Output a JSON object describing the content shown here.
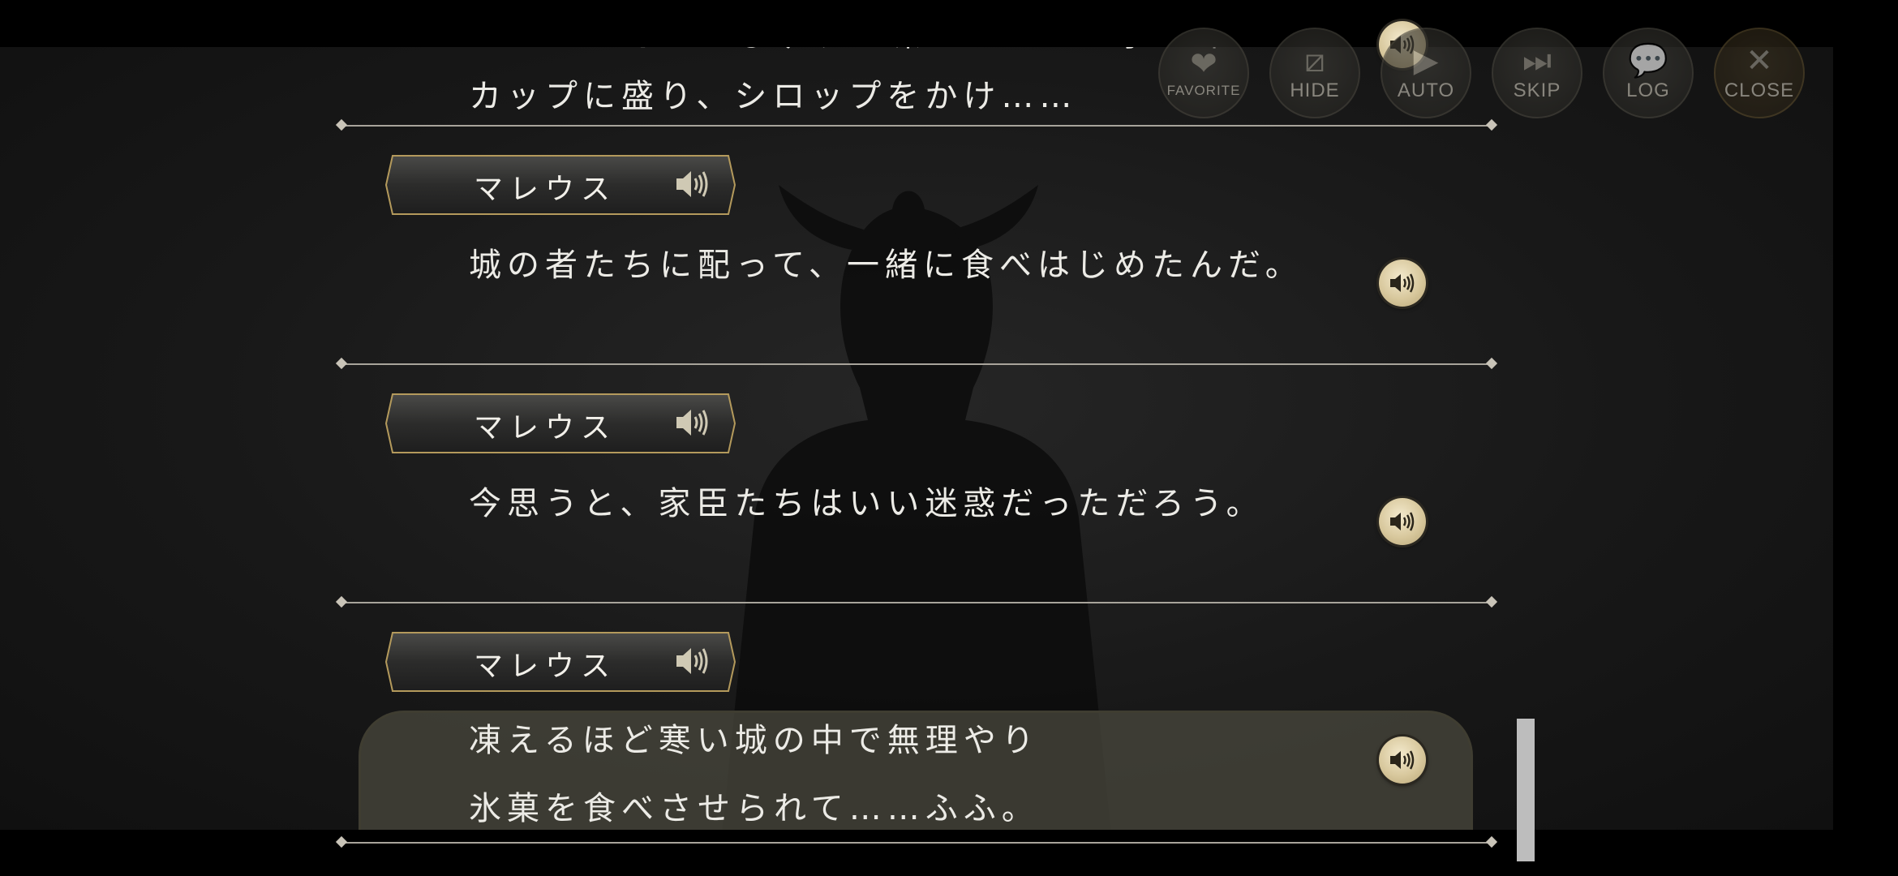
{
  "toolbar": {
    "buttons": [
      {
        "id": "favorite",
        "label": "FAVORITE",
        "icon": "heart-icon",
        "glyph": "❤"
      },
      {
        "id": "hide",
        "label": "HIDE",
        "icon": "hide-icon",
        "glyph": "⧄"
      },
      {
        "id": "auto",
        "label": "AUTO",
        "icon": "auto-icon",
        "glyph": "▶"
      },
      {
        "id": "skip",
        "label": "SKIP",
        "icon": "skip-icon",
        "glyph": "⏭"
      },
      {
        "id": "log",
        "label": "LOG",
        "icon": "chat-bubble-icon",
        "glyph": "💬"
      },
      {
        "id": "close",
        "label": "CLOSE",
        "icon": "close-icon",
        "glyph": "✕"
      }
    ]
  },
  "log": {
    "top_partial": {
      "line1": "リリアはそこらじゅうを凍らせていた氷を砕いて",
      "line2": "カップに盛り、シロップをかけ……"
    },
    "entries": [
      {
        "speaker": "マレウス",
        "lines": [
          "城の者たちに配って、一緒に食べはじめたんだ。"
        ]
      },
      {
        "speaker": "マレウス",
        "lines": [
          "今思うと、家臣たちはいい迷惑だっただろう。"
        ]
      },
      {
        "speaker": "マレウス",
        "lines": [
          "凍えるほど寒い城の中で無理やり",
          "氷菓を食べさせられて……ふふ。"
        ]
      }
    ]
  },
  "colors": {
    "gold": "#d8c89d",
    "nameplate_border": "#b49a5c",
    "text": "#ecebe6",
    "current_box": "#48463c"
  }
}
